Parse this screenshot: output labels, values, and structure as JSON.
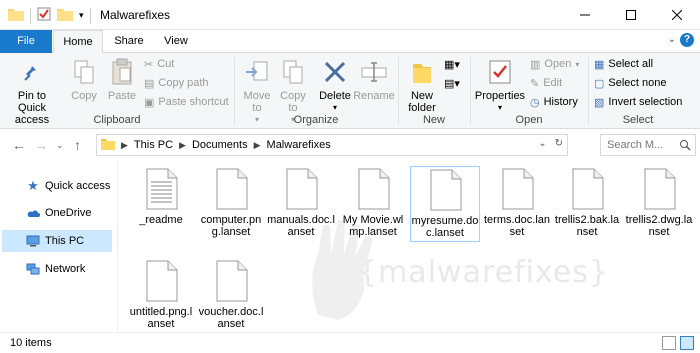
{
  "window": {
    "title": "Malwarefixes"
  },
  "tabs": [
    {
      "label": "File"
    },
    {
      "label": "Home"
    },
    {
      "label": "Share"
    },
    {
      "label": "View"
    }
  ],
  "ribbon": {
    "clipboard": {
      "label": "Clipboard",
      "pin": "Pin to Quick access",
      "copy": "Copy",
      "paste": "Paste",
      "cut": "Cut",
      "copy_path": "Copy path",
      "paste_shortcut": "Paste shortcut"
    },
    "organize": {
      "label": "Organize",
      "move_to": "Move to",
      "copy_to": "Copy to",
      "delete": "Delete",
      "rename": "Rename"
    },
    "new": {
      "label": "New",
      "new_folder": "New folder"
    },
    "open": {
      "label": "Open",
      "properties": "Properties",
      "open": "Open",
      "edit": "Edit",
      "history": "History"
    },
    "select": {
      "label": "Select",
      "select_all": "Select all",
      "select_none": "Select none",
      "invert": "Invert selection"
    }
  },
  "address": {
    "crumbs": [
      "This PC",
      "Documents",
      "Malwarefixes"
    ],
    "search_placeholder": "Search M..."
  },
  "nav": {
    "items": [
      {
        "label": "Quick access"
      },
      {
        "label": "OneDrive"
      },
      {
        "label": "This PC"
      },
      {
        "label": "Network"
      }
    ]
  },
  "files": [
    {
      "name": "_readme"
    },
    {
      "name": "computer.png.lanset"
    },
    {
      "name": "manuals.doc.lanset"
    },
    {
      "name": "My Movie.wlmp.lanset"
    },
    {
      "name": "myresume.doc.lanset"
    },
    {
      "name": "terms.doc.lanset"
    },
    {
      "name": "trellis2.bak.lanset"
    },
    {
      "name": "trellis2.dwg.lanset"
    },
    {
      "name": "untitled.png.lanset"
    },
    {
      "name": "voucher.doc.lanset"
    }
  ],
  "status": {
    "count": "10 items"
  },
  "colors": {
    "accent": "#1979ca",
    "selection": "#cce8ff"
  }
}
